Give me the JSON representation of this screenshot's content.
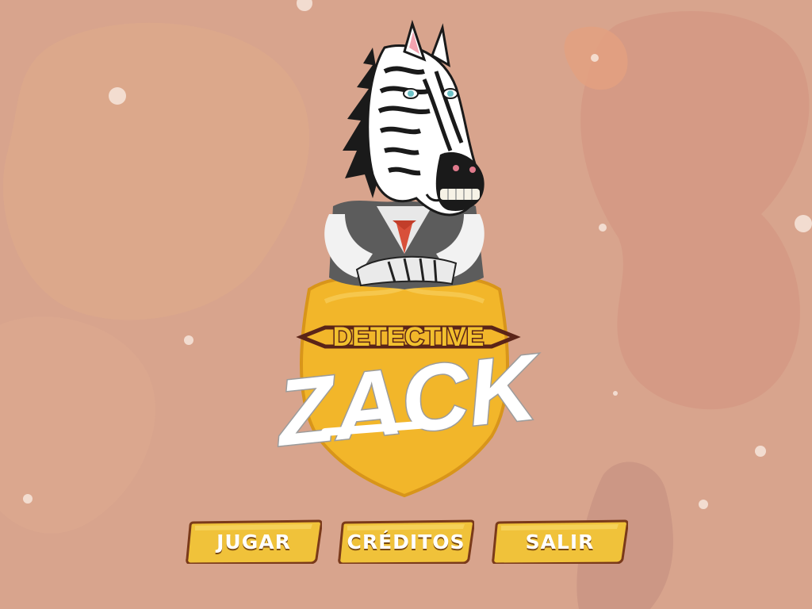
{
  "game": {
    "title_top": "DETECTIVE",
    "title_main": "ZACK"
  },
  "menu": {
    "play_label": "JUGAR",
    "credits_label": "CRÉDITOS",
    "exit_label": "SALIR"
  },
  "colors": {
    "background": "#d8a48d",
    "badge": "#f2b62a",
    "button": "#f0c23a",
    "button_border": "#7a3a1a",
    "title_text": "#5a2418"
  }
}
